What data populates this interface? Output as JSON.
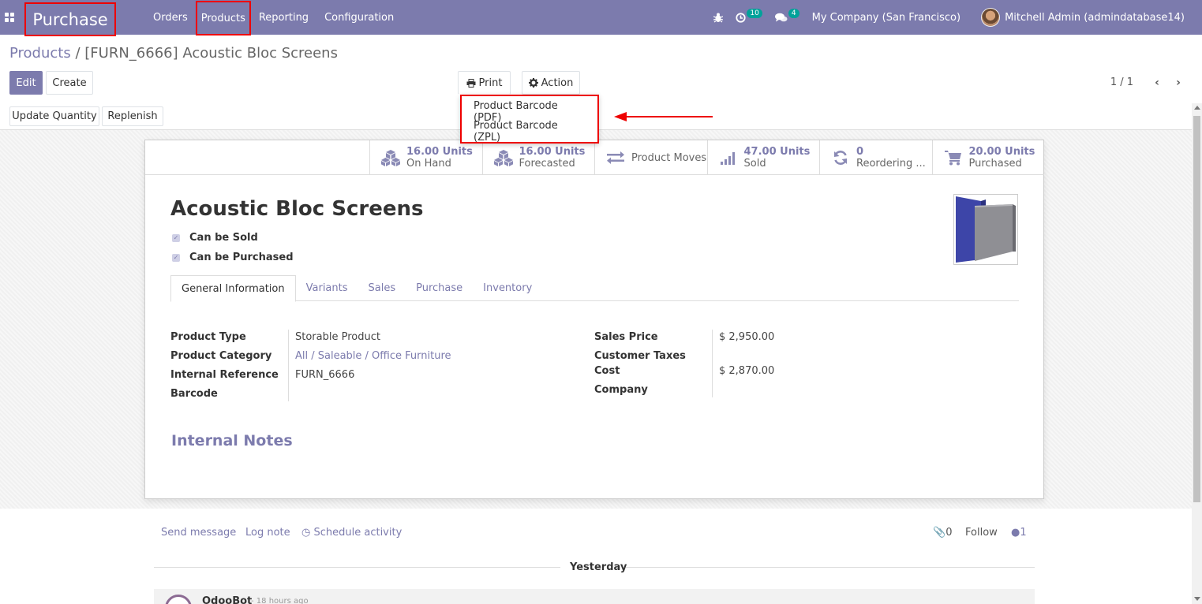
{
  "navbar": {
    "app_name": "Purchase",
    "menu": [
      "Orders",
      "Products",
      "Reporting",
      "Configuration"
    ],
    "activity_count": "10",
    "message_count": "4",
    "company": "My Company (San Francisco)",
    "user": "Mitchell Admin (admindatabase14)",
    "colors": {
      "bar": "#7c7bad",
      "highlight_border": "#ee0000",
      "badge": "#01a29a"
    }
  },
  "breadcrumb": {
    "parent": "Products",
    "separator": "/",
    "current": "[FURN_6666] Acoustic Bloc Screens"
  },
  "buttons": {
    "edit": "Edit",
    "create": "Create",
    "print": "Print",
    "action": "Action",
    "update_quantity": "Update Quantity",
    "replenish": "Replenish"
  },
  "print_menu": [
    "Product Barcode (PDF)",
    "Product Barcode (ZPL)"
  ],
  "pager": {
    "value": "1 / 1"
  },
  "smart_buttons": [
    {
      "value": "16.00 Units",
      "label": "On Hand",
      "icon": "cubes-icon"
    },
    {
      "value": "16.00 Units",
      "label": "Forecasted",
      "icon": "cubes-icon"
    },
    {
      "value": "",
      "label": "Product Moves",
      "icon": "exchange-icon"
    },
    {
      "value": "47.00 Units",
      "label": "Sold",
      "icon": "signal-icon"
    },
    {
      "value": "0",
      "label": "Reordering ...",
      "icon": "refresh-icon"
    },
    {
      "value": "20.00 Units",
      "label": "Purchased",
      "icon": "cart-icon"
    }
  ],
  "product": {
    "name": "Acoustic Bloc Screens",
    "can_be_sold": "Can be Sold",
    "can_be_purchased": "Can be Purchased"
  },
  "tabs": [
    "General Information",
    "Variants",
    "Sales",
    "Purchase",
    "Inventory"
  ],
  "fields_left": [
    {
      "label": "Product Type",
      "value": "Storable Product"
    },
    {
      "label": "Product Category",
      "value": "All / Saleable / Office Furniture"
    },
    {
      "label": "Internal Reference",
      "value": "FURN_6666"
    },
    {
      "label": "Barcode",
      "value": ""
    }
  ],
  "fields_right": [
    {
      "label": "Sales Price",
      "value": "$ 2,950.00"
    },
    {
      "label": "Customer Taxes",
      "value": ""
    },
    {
      "label": "Cost",
      "value": "$ 2,870.00"
    },
    {
      "label": "Company",
      "value": ""
    }
  ],
  "notes_title": "Internal Notes",
  "chatter": {
    "send_message": "Send message",
    "log_note": "Log note",
    "schedule_activity": "Schedule activity",
    "attachments": "0",
    "follow": "Follow",
    "followers": "1",
    "day_label": "Yesterday",
    "author": "OdooBot",
    "time": "- 18 hours ago"
  }
}
